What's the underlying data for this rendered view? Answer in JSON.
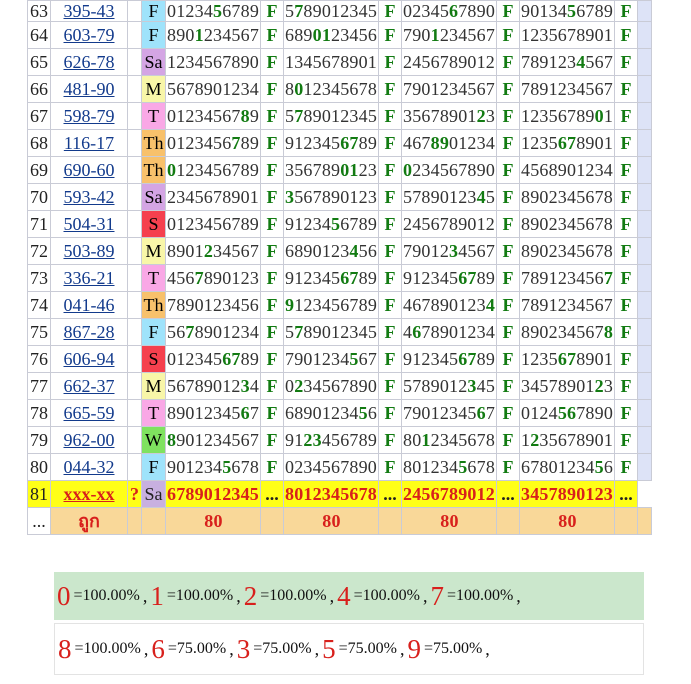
{
  "rows": [
    {
      "no": "63",
      "code": "395-43",
      "day": "F",
      "nums": [
        "0123456789",
        "5789012345",
        "0234567890",
        "9013456789"
      ]
    },
    {
      "no": "64",
      "code": "603-79",
      "day": "F",
      "nums": [
        "8901234567",
        "6890123456",
        "7901234567",
        "1235678901"
      ]
    },
    {
      "no": "65",
      "code": "626-78",
      "day": "Sa",
      "nums": [
        "1234567890",
        "1345678901",
        "2456789012",
        "7891234567"
      ]
    },
    {
      "no": "66",
      "code": "481-90",
      "day": "M",
      "nums": [
        "5678901234",
        "8012345678",
        "7901234567",
        "7891234567"
      ]
    },
    {
      "no": "67",
      "code": "598-79",
      "day": "T",
      "nums": [
        "0123456789",
        "5789012345",
        "3567890123",
        "1235678901"
      ]
    },
    {
      "no": "68",
      "code": "116-17",
      "day": "Th",
      "nums": [
        "0123456789",
        "9123456789",
        "4678901234",
        "1235678901"
      ]
    },
    {
      "no": "69",
      "code": "690-60",
      "day": "Th",
      "nums": [
        "0123456789",
        "3567890123",
        "0234567890",
        "4568901234"
      ]
    },
    {
      "no": "70",
      "code": "593-42",
      "day": "Sa",
      "nums": [
        "2345678901",
        "3567890123",
        "5789012345",
        "8902345678"
      ]
    },
    {
      "no": "71",
      "code": "504-31",
      "day": "S",
      "nums": [
        "0123456789",
        "9123456789",
        "2456789012",
        "8902345678"
      ]
    },
    {
      "no": "72",
      "code": "503-89",
      "day": "M",
      "nums": [
        "8901234567",
        "6890123456",
        "7901234567",
        "8902345678"
      ]
    },
    {
      "no": "73",
      "code": "336-21",
      "day": "T",
      "nums": [
        "4567890123",
        "9123456789",
        "9123456789",
        "7891234567"
      ]
    },
    {
      "no": "74",
      "code": "041-46",
      "day": "Th",
      "nums": [
        "7890123456",
        "9123456789",
        "4678901234",
        "7891234567"
      ]
    },
    {
      "no": "75",
      "code": "867-28",
      "day": "F",
      "nums": [
        "5678901234",
        "5789012345",
        "4678901234",
        "8902345678"
      ]
    },
    {
      "no": "76",
      "code": "606-94",
      "day": "S",
      "nums": [
        "0123456789",
        "7901234567",
        "9123456789",
        "1235678901"
      ]
    },
    {
      "no": "77",
      "code": "662-37",
      "day": "M",
      "nums": [
        "5678901234",
        "0234567890",
        "5789012345",
        "3457890123"
      ]
    },
    {
      "no": "78",
      "code": "665-59",
      "day": "T",
      "nums": [
        "8901234567",
        "6890123456",
        "7901234567",
        "0124567890"
      ]
    },
    {
      "no": "79",
      "code": "962-00",
      "day": "W",
      "nums": [
        "8901234567",
        "9123456789",
        "8012345678",
        "1235678901"
      ]
    },
    {
      "no": "80",
      "code": "044-32",
      "day": "F",
      "nums": [
        "9012345678",
        "0234567890",
        "8012345678",
        "6780123456"
      ]
    }
  ],
  "highlights": [
    [
      [
        5
      ],
      [
        1
      ],
      [
        5
      ],
      [
        5
      ]
    ],
    [
      [
        3
      ],
      [
        3,
        4
      ],
      [
        3
      ],
      []
    ],
    [
      [],
      [],
      [],
      [
        6
      ]
    ],
    [
      [],
      [
        1
      ],
      [],
      []
    ],
    [
      [
        8
      ],
      [
        1
      ],
      [
        8
      ],
      [
        8
      ]
    ],
    [
      [
        7
      ],
      [
        6,
        7
      ],
      [
        3,
        4
      ],
      [
        4,
        5
      ]
    ],
    [
      [
        0
      ],
      [
        6,
        7
      ],
      [
        0
      ],
      []
    ],
    [
      [],
      [
        0
      ],
      [
        8
      ],
      []
    ],
    [
      [],
      [
        5
      ],
      [],
      []
    ],
    [
      [
        4
      ],
      [
        7
      ],
      [
        5
      ],
      []
    ],
    [
      [
        3
      ],
      [
        6,
        7
      ],
      [
        6,
        7
      ],
      [
        9
      ]
    ],
    [
      [],
      [
        0
      ],
      [
        9
      ],
      []
    ],
    [
      [
        2
      ],
      [
        1
      ],
      [
        1
      ],
      [
        9
      ]
    ],
    [
      [
        6,
        7
      ],
      [
        7
      ],
      [
        6,
        7
      ],
      [
        4,
        5
      ]
    ],
    [
      [
        8
      ],
      [
        1
      ],
      [
        7
      ],
      [
        8
      ]
    ],
    [
      [
        8
      ],
      [
        8
      ],
      [
        8
      ],
      [
        4,
        5
      ]
    ],
    [
      [
        0
      ],
      [
        2,
        3
      ],
      [
        2
      ],
      [
        1
      ]
    ],
    [
      [
        6
      ],
      [],
      [
        6
      ],
      [
        8
      ]
    ]
  ],
  "predict_row": {
    "no": "81",
    "code": "xxx-xx",
    "q": "?",
    "day": "Sa",
    "nums": [
      "6789012345",
      "8012345678",
      "2456789012",
      "3457890123"
    ],
    "dots": "..."
  },
  "total_row": {
    "no": "...",
    "label": "ถูก",
    "counts": [
      "80",
      "80",
      "80",
      "80"
    ]
  },
  "f_label": "F",
  "summary": {
    "line1": [
      {
        "digit": "0",
        "pct": "=100.00%"
      },
      {
        "digit": "1",
        "pct": "=100.00%"
      },
      {
        "digit": "2",
        "pct": "=100.00%"
      },
      {
        "digit": "4",
        "pct": "=100.00%"
      },
      {
        "digit": "7",
        "pct": "=100.00%"
      }
    ],
    "line2": [
      {
        "digit": "8",
        "pct": "=100.00%"
      },
      {
        "digit": "6",
        "pct": "=75.00%"
      },
      {
        "digit": "3",
        "pct": "=75.00%"
      },
      {
        "digit": "5",
        "pct": "=75.00%"
      },
      {
        "digit": "9",
        "pct": "=75.00%"
      }
    ]
  }
}
